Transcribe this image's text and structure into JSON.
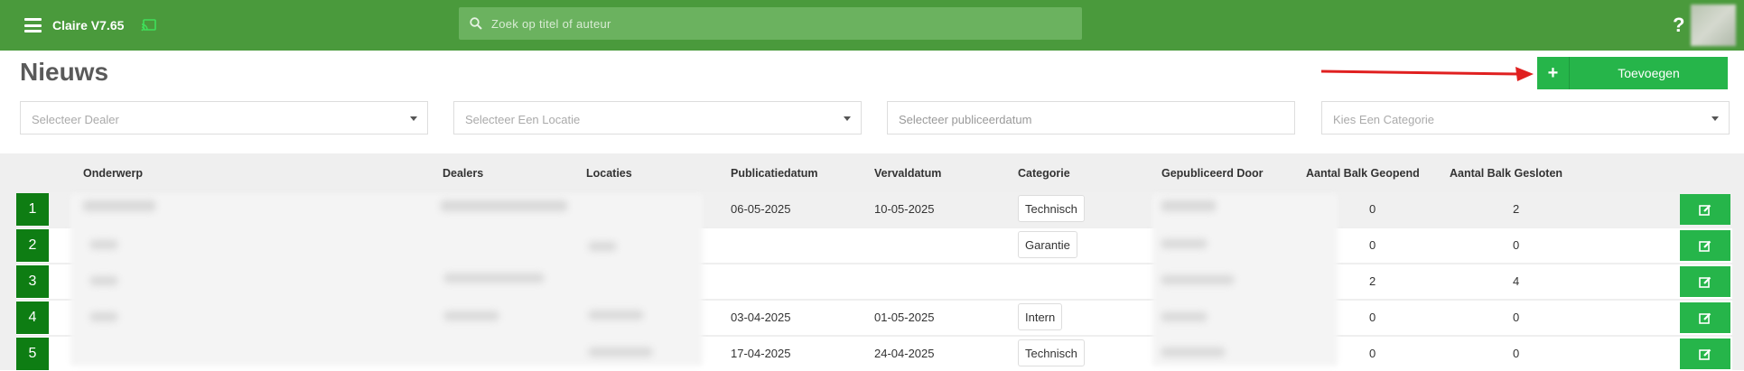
{
  "header": {
    "app_title": "Claire V7.65",
    "search_placeholder": "Zoek op titel of auteur",
    "help_label": "?"
  },
  "page": {
    "title": "Nieuws",
    "add_button_label": "Toevoegen",
    "add_button_icon": "+"
  },
  "filters": {
    "dealer_placeholder": "Selecteer Dealer",
    "location_placeholder": "Selecteer Een Locatie",
    "date_placeholder": "Selecteer publiceerdatum",
    "category_placeholder": "Kies Een Categorie"
  },
  "table": {
    "columns": [
      "Onderwerp",
      "Dealers",
      "Locaties",
      "Publicatiedatum",
      "Vervaldatum",
      "Categorie",
      "Gepubliceerd Door",
      "Aantal Balk Geopend",
      "Aantal Balk Gesloten"
    ],
    "rows": [
      {
        "index": "1",
        "publicatiedatum": "06-05-2025",
        "vervaldatum": "10-05-2025",
        "categorie": "Technisch",
        "geopend": "0",
        "gesloten": "2"
      },
      {
        "index": "2",
        "publicatiedatum": "",
        "vervaldatum": "",
        "categorie": "Garantie",
        "geopend": "0",
        "gesloten": "0"
      },
      {
        "index": "3",
        "publicatiedatum": "",
        "vervaldatum": "",
        "categorie": "",
        "geopend": "2",
        "gesloten": "4"
      },
      {
        "index": "4",
        "publicatiedatum": "03-04-2025",
        "vervaldatum": "01-05-2025",
        "categorie": "Intern",
        "geopend": "0",
        "gesloten": "0"
      },
      {
        "index": "5",
        "publicatiedatum": "17-04-2025",
        "vervaldatum": "24-04-2025",
        "categorie": "Technisch",
        "geopend": "0",
        "gesloten": "0"
      }
    ]
  },
  "colors": {
    "topbar": "#4a9a3c",
    "accent_green": "#26b54a",
    "row_index_green": "#0e7d13",
    "annotation_arrow": "#e02020"
  },
  "icons": {
    "menu": "hamburger-icon",
    "cast": "cast-icon",
    "search": "search-icon",
    "help": "help-icon",
    "add": "plus-icon",
    "edit": "edit-icon"
  }
}
